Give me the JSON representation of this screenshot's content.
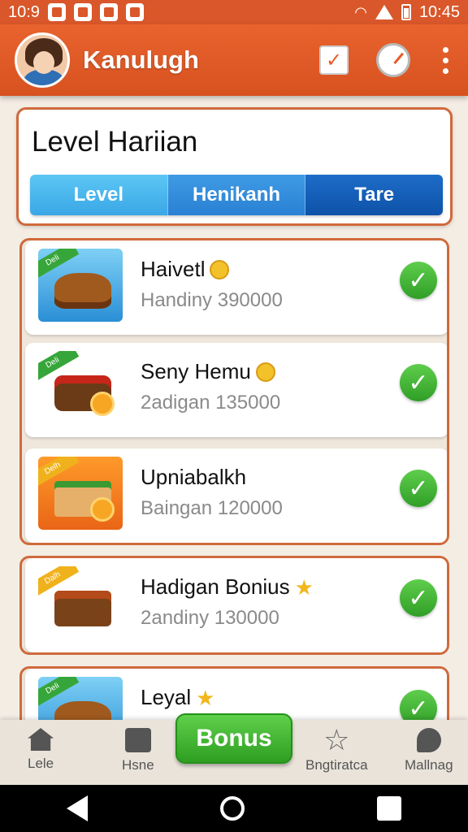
{
  "status_bar": {
    "time_left": "10:9",
    "time_right": "10:45"
  },
  "app_bar": {
    "title": "Kanulugh"
  },
  "level_card": {
    "title": "Level Hariian",
    "segments": [
      "Level",
      "Henikanh",
      "Tare"
    ]
  },
  "groups": [
    {
      "items": [
        {
          "title": "Haivetl",
          "subtitle": "Handiny  390000",
          "thumb_label": "Deli"
        },
        {
          "title": "Seny Hemu",
          "subtitle": "2adigan  135000",
          "thumb_label": "Deli"
        },
        {
          "title": "Upniabalkh",
          "subtitle": "Baingan  120000",
          "thumb_label": "Delh"
        }
      ]
    },
    {
      "items": [
        {
          "title": "Hadigan Bonius",
          "subtitle": "2andiny  130000",
          "thumb_label": "Dalh"
        }
      ]
    },
    {
      "items": [
        {
          "title": "Leyal",
          "subtitle": "",
          "thumb_label": "Deli"
        }
      ]
    }
  ],
  "bottom_nav": {
    "items": [
      "Lele",
      "Hsne",
      "Bngtiratca",
      "Mallnag"
    ],
    "bonus_label": "Bonus"
  },
  "colors": {
    "brand": "#e15b27",
    "accent_green": "#3cb131",
    "accent_blue": "#1a6cc8"
  }
}
